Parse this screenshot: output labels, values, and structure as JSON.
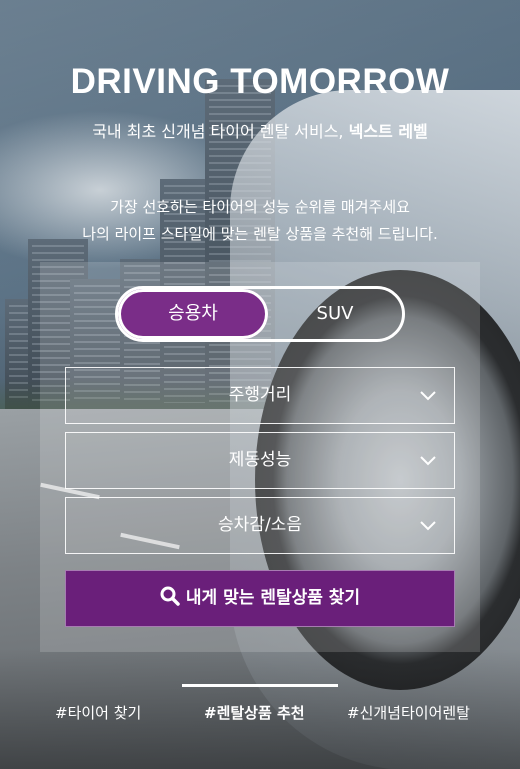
{
  "hero": {
    "title": "DRIVING TOMORROW",
    "subtitle_prefix": "국내 최초 신개념 타이어 렌탈 서비스, ",
    "subtitle_brand": "넥스트 레벨"
  },
  "intro": {
    "line1": "가장 선호하는 타이어의 성능 순위를 매겨주세요",
    "line2": "나의 라이프 스타일에 맞는 렌탈 상품을 추천해 드립니다."
  },
  "vehicle_toggle": {
    "options": [
      "승용차",
      "SUV"
    ],
    "selected": "승용차"
  },
  "ranking_selects": [
    {
      "label": "주행거리"
    },
    {
      "label": "제동성능"
    },
    {
      "label": "승차감/소음"
    }
  ],
  "cta": {
    "label": "내게 맞는 렌탈상품 찾기"
  },
  "tabs": [
    {
      "label": "#타이어 찾기"
    },
    {
      "label": "#렌탈상품 추천"
    },
    {
      "label": "#신개념타이어렌탈"
    }
  ],
  "active_tab": "#렌탈상품 추천",
  "colors": {
    "accent": "#6a1f7a",
    "toggle_active": "#7a2d88",
    "text": "#ffffff"
  }
}
